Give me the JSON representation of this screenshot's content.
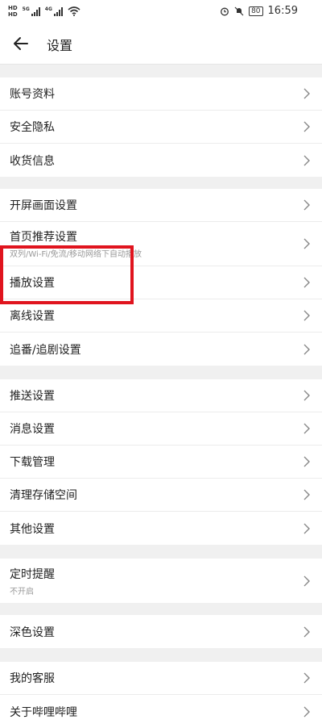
{
  "status_bar": {
    "hd1": "HD",
    "hd2": "HD",
    "net1": "5G",
    "net2": "4G",
    "battery": "80",
    "time": "16:59"
  },
  "header": {
    "title": "设置"
  },
  "groups": [
    {
      "items": [
        {
          "label": "账号资料"
        },
        {
          "label": "安全隐私"
        },
        {
          "label": "收货信息"
        }
      ]
    },
    {
      "items": [
        {
          "label": "开屏画面设置"
        },
        {
          "label": "首页推荐设置",
          "sub": "双列/Wi-Fi/免流/移动网络下自动播放"
        },
        {
          "label": "播放设置"
        },
        {
          "label": "离线设置"
        },
        {
          "label": "追番/追剧设置"
        }
      ]
    },
    {
      "items": [
        {
          "label": "推送设置"
        },
        {
          "label": "消息设置"
        },
        {
          "label": "下载管理"
        },
        {
          "label": "清理存储空间"
        },
        {
          "label": "其他设置"
        }
      ]
    },
    {
      "items": [
        {
          "label": "定时提醒",
          "sub": "不开启"
        }
      ]
    },
    {
      "items": [
        {
          "label": "深色设置"
        }
      ]
    },
    {
      "items": [
        {
          "label": "我的客服"
        },
        {
          "label": "关于哔哩哔哩"
        }
      ]
    }
  ],
  "highlight_color": "#e0141e"
}
